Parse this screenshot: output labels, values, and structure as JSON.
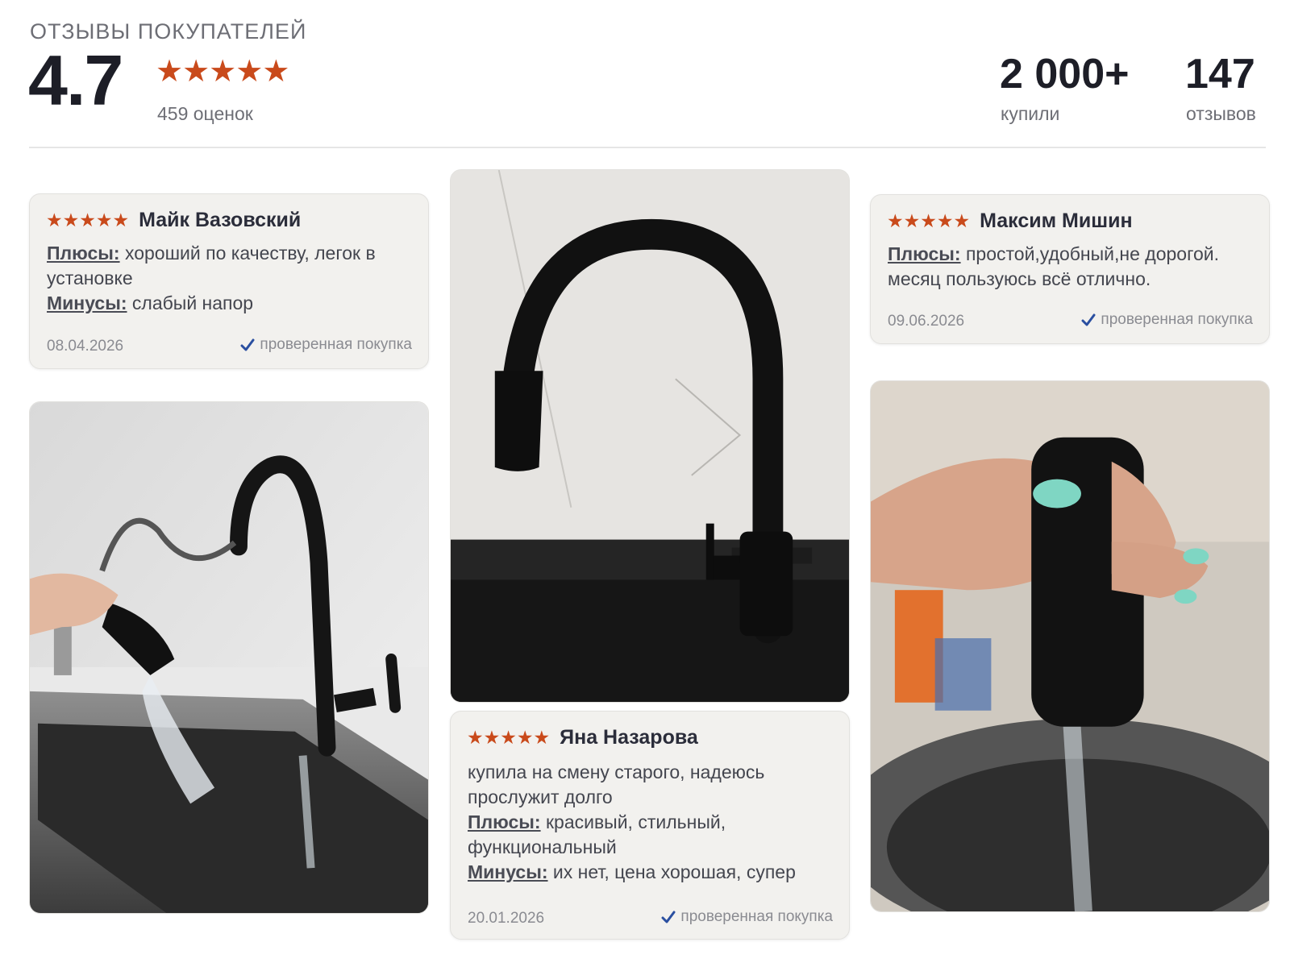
{
  "header": {
    "title": "ОТЗЫВЫ ПОКУПАТЕЛЕЙ",
    "rating": "4.7",
    "stars_filled": 5,
    "ratings_count": "459 оценок",
    "bought_value": "2 000+",
    "bought_label": "купили",
    "reviews_value": "147",
    "reviews_label": "отзывов"
  },
  "colors": {
    "star": "#c94a1b",
    "check": "#2a4fa0",
    "card_bg": "#f2f1ee"
  },
  "reviews": [
    {
      "author": "Майк Вазовский",
      "stars": 5,
      "pros_label": "Плюсы:",
      "pros": "хороший по качеству, легок в установке",
      "cons_label": "Минусы:",
      "cons": "слабый напор",
      "date": "08.04.2026",
      "verified": "проверенная покупка"
    },
    {
      "author": "Яна Назарова",
      "stars": 5,
      "comment": "купила на смену старого, надеюсь прослужит долго",
      "pros_label": "Плюсы:",
      "pros": "красивый, стильный, функциональный",
      "cons_label": "Минусы:",
      "cons": "их нет, цена хорошая, супер",
      "date": "20.01.2026",
      "verified": "проверенная покупка"
    },
    {
      "author": "Максим Мишин",
      "stars": 5,
      "pros_label": "Плюсы:",
      "pros": "простой,удобный,не дорогой. месяц пользуюсь всё отлично.",
      "date": "09.06.2026",
      "verified": "проверенная покупка"
    }
  ],
  "photos": [
    {
      "name": "faucet-sink-spray-photo"
    },
    {
      "name": "black-faucet-installed-photo"
    },
    {
      "name": "hand-holding-spray-head-photo"
    }
  ]
}
